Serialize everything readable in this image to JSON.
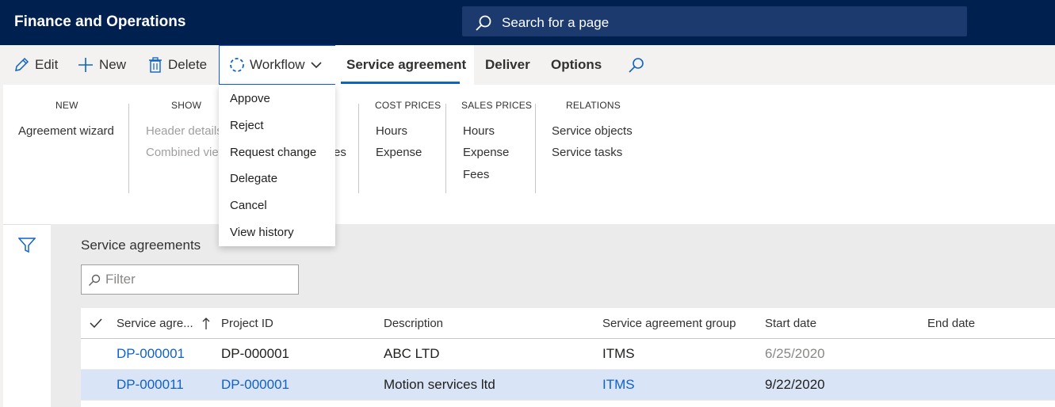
{
  "app": {
    "title": "Finance and Operations"
  },
  "search": {
    "placeholder": "Search for a page"
  },
  "actions": {
    "edit": "Edit",
    "new": "New",
    "delete": "Delete",
    "workflow": "Workflow"
  },
  "tabs": {
    "service_agreement": "Service agreement",
    "deliver": "Deliver",
    "options": "Options"
  },
  "workflow_menu": [
    "Appove",
    "Reject",
    "Request change",
    "Delegate",
    "Cancel",
    "View history"
  ],
  "ribbon": {
    "new": {
      "title": "NEW",
      "items": [
        "Agreement wizard"
      ]
    },
    "show": {
      "title": "SHOW",
      "items": [
        "Header details",
        "Combined view"
      ]
    },
    "hidden_fragment": "es",
    "cost_prices": {
      "title": "COST PRICES",
      "items": [
        "Hours",
        "Expense"
      ]
    },
    "sales_prices": {
      "title": "SALES PRICES",
      "items": [
        "Hours",
        "Expense",
        "Fees"
      ]
    },
    "relations": {
      "title": "RELATIONS",
      "items": [
        "Service objects",
        "Service tasks"
      ]
    }
  },
  "grid": {
    "title": "Service agreements",
    "filter_placeholder": "Filter",
    "columns": [
      "Service agre...",
      "Project ID",
      "Description",
      "Service agreement group",
      "Start date",
      "End date"
    ],
    "rows": [
      {
        "id": "DP-000001",
        "project": "DP-000001",
        "description": "ABC LTD",
        "group": "ITMS",
        "start": "6/25/2020",
        "end": ""
      },
      {
        "id": "DP-000011",
        "project": "DP-000001",
        "description": "Motion services ltd",
        "group": "ITMS",
        "start": "9/22/2020",
        "end": ""
      }
    ]
  },
  "colors": {
    "topbar": "#002050",
    "accent": "#0f62c6",
    "selected_row": "#d9e4f7"
  }
}
